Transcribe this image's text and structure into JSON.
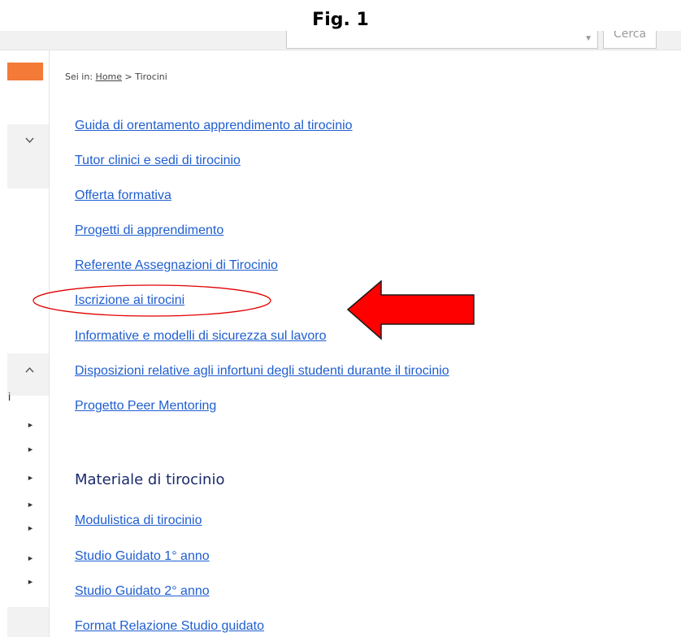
{
  "figure_title": "Fig. 1",
  "header": {
    "search_button_label": "Cerca"
  },
  "breadcrumb": {
    "prefix": "Sei in:",
    "home": "Home",
    "separator": ">",
    "current": "Tirocini"
  },
  "sidebar": {
    "fragment_letter": "i"
  },
  "links": [
    "Guida di orentamento apprendimento al tirocinio",
    "Tutor clinici e sedi di tirocinio",
    "Offerta formativa",
    "Progetti di apprendimento",
    "Referente Assegnazioni di Tirocinio",
    "Iscrizione ai tirocini",
    "Informative e modelli di sicurezza sul lavoro",
    "Disposizioni relative agli infortuni degli studenti durante il tirocinio",
    "Progetto Peer Mentoring"
  ],
  "material_section": {
    "heading": "Materiale di tirocinio",
    "links": [
      "Modulistica di tirocinio",
      "Studio Guidato 1° anno",
      "Studio Guidato 2° anno",
      "Format Relazione Studio guidato"
    ]
  },
  "colors": {
    "link": "#1f5ed0",
    "accent_orange": "#f47a37",
    "annotation_red": "#e00000",
    "heading": "#1a2a6c"
  },
  "icons": {
    "annotation_arrow": "red-left-arrow-icon",
    "annotation_circle": "red-ellipse-highlight"
  }
}
